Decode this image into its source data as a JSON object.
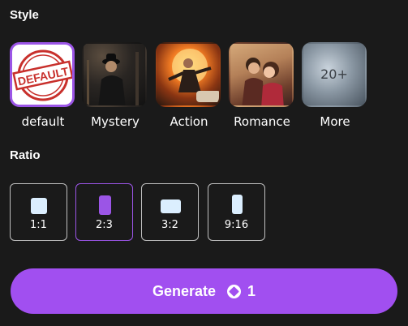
{
  "style": {
    "title": "Style",
    "items": [
      {
        "label": "default",
        "thumb_text": "DEFAULT",
        "selected": true
      },
      {
        "label": "Mystery",
        "selected": false
      },
      {
        "label": "Action",
        "selected": false
      },
      {
        "label": "Romance",
        "selected": false
      },
      {
        "label": "More",
        "thumb_text": "20+",
        "selected": false
      }
    ]
  },
  "ratio": {
    "title": "Ratio",
    "options": [
      {
        "label": "1:1",
        "selected": false
      },
      {
        "label": "2:3",
        "selected": true
      },
      {
        "label": "3:2",
        "selected": false
      },
      {
        "label": "9:16",
        "selected": false
      }
    ]
  },
  "generate": {
    "label": "Generate",
    "cost": "1",
    "icon": "coin-icon"
  },
  "colors": {
    "background": "#1a1a1a",
    "accent": "#a14ff0",
    "selected_border": "#9b55e6",
    "ratio_shape": "#dbeefe"
  }
}
